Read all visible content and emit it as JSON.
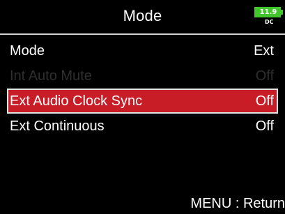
{
  "header": {
    "title": "Mode"
  },
  "battery": {
    "value": "11.9",
    "source": "DC",
    "color": "#41c72b"
  },
  "menu": {
    "items": [
      {
        "label": "Mode",
        "value": "Ext",
        "state": "normal"
      },
      {
        "label": "Int Auto Mute",
        "value": "Off",
        "state": "disabled"
      },
      {
        "label": "Ext Audio Clock Sync",
        "value": "Off",
        "state": "selected"
      },
      {
        "label": "Ext Continuous",
        "value": "Off",
        "state": "normal"
      }
    ]
  },
  "footer": {
    "hint": "MENU : Return"
  },
  "colors": {
    "background": "#000000",
    "selection": "#c81d26",
    "disabled_text": "#2f2f2f",
    "text": "#ffffff"
  }
}
